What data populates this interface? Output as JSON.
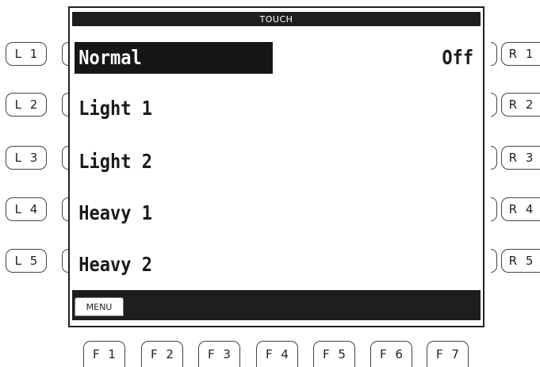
{
  "screen": {
    "title": "TOUCH",
    "items": [
      {
        "label": "Normal",
        "selected": true
      },
      {
        "label": "Light 1",
        "selected": false
      },
      {
        "label": "Light 2",
        "selected": false
      },
      {
        "label": "Heavy 1",
        "selected": false
      },
      {
        "label": "Heavy 2",
        "selected": false
      }
    ],
    "value": "Off",
    "menu_label": "MENU"
  },
  "left_buttons": [
    "L 1",
    "L 2",
    "L 3",
    "L 4",
    "L 5"
  ],
  "right_buttons": [
    "R 1",
    "R 2",
    "R 3",
    "R 4",
    "R 5"
  ],
  "function_buttons": [
    "F 1",
    "F 2",
    "F 3",
    "F 4",
    "F 5",
    "F 6",
    "F 7"
  ],
  "colors": {
    "screen_dark": "#1e1e1e",
    "background": "#ffffff",
    "text": "#1a1a1a"
  }
}
